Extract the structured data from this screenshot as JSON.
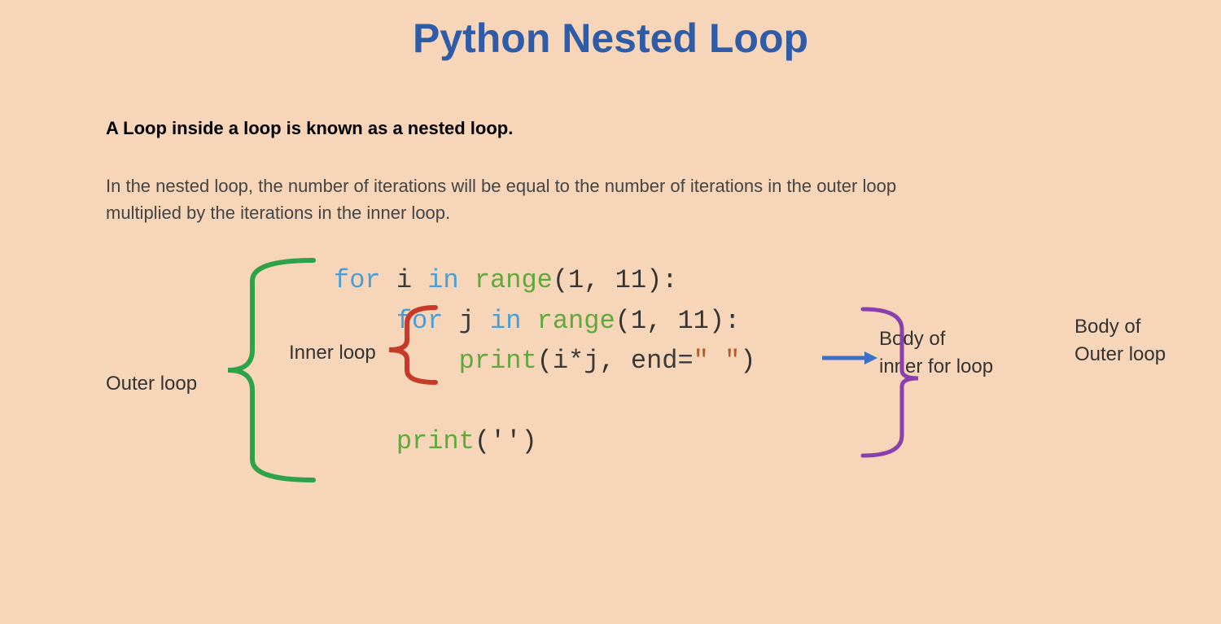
{
  "title": "Python Nested Loop",
  "subtitle": "A Loop inside a loop is known as a nested loop.",
  "desc_line1": "In the nested loop, the number of iterations will be equal to the number of iterations in the outer loop",
  "desc_line2": "multiplied by the iterations in the inner loop.",
  "code": {
    "l1": {
      "for": "for",
      "i": "i",
      "in": "in",
      "range": "range",
      "args": "(1, 11):"
    },
    "l2": {
      "for": "for",
      "j": "j",
      "in": "in",
      "range": "range",
      "args": "(1, 11):"
    },
    "l3": {
      "print": "print",
      "open": "(",
      "expr": "i*j",
      "comma": ",",
      "end_kw": " end=",
      "end_val": "\" \"",
      "close": ")"
    },
    "l4": {
      "print": "print",
      "args": "('')"
    }
  },
  "labels": {
    "outer_loop": "Outer loop",
    "inner_loop": "Inner loop",
    "body_inner_l1": "Body of",
    "body_inner_l2": "inner for loop",
    "body_outer_l1": "Body of",
    "body_outer_l2": "Outer loop"
  },
  "colors": {
    "title": "#2e5ca8",
    "bg": "#f7d5b8",
    "green": "#2da24a",
    "red": "#c63a2a",
    "blue_arrow": "#3a6fc9",
    "purple": "#8a3fad"
  }
}
